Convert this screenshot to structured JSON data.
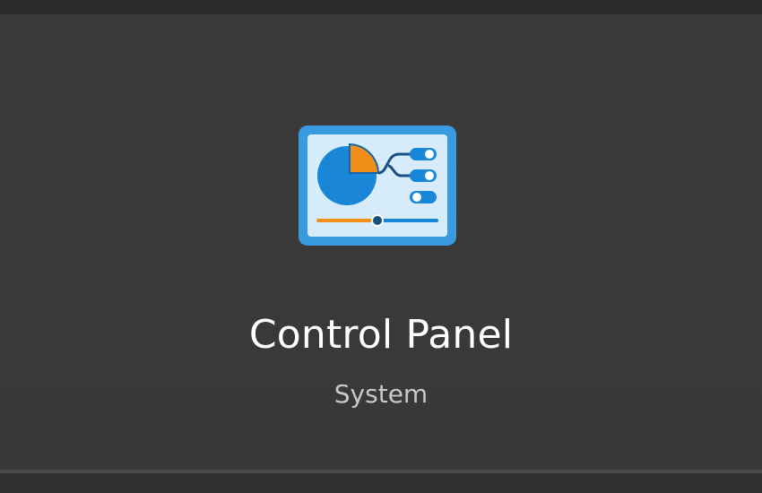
{
  "result": {
    "title": "Control Panel",
    "subtitle": "System",
    "icon": "control-panel-icon"
  },
  "colors": {
    "background": "#3a3938",
    "icon_frame": "#3a9ae0",
    "icon_screen": "#d6ecfb",
    "pie_blue": "#1a86d8",
    "pie_orange": "#f0901a",
    "title_text": "#ffffff",
    "subtitle_text": "#c8c8c8"
  }
}
